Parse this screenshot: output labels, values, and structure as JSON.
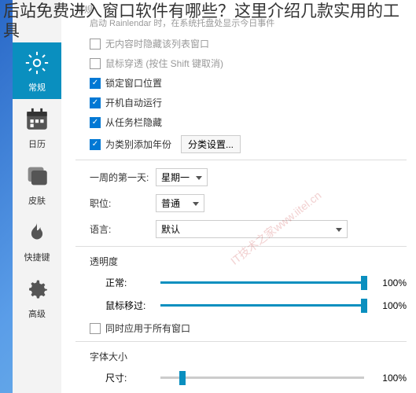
{
  "overlay": {
    "text": "后站免费进入窗口软件有哪些？这里介绍几款实用的工具"
  },
  "watermark": "IT技术之家www.iitel.cn",
  "section": {
    "title": "常规",
    "hint": "启动 Rainlendar 时，在系统托盘处显示今日事件"
  },
  "sidebar": {
    "items": [
      {
        "label": "常规",
        "icon": "gear"
      },
      {
        "label": "日历",
        "icon": "calendar"
      },
      {
        "label": "皮肤",
        "icon": "window"
      },
      {
        "label": "快捷键",
        "icon": "flame"
      },
      {
        "label": "高级",
        "icon": "cog"
      }
    ]
  },
  "checkboxes": {
    "hide_no_content": {
      "label": "无内容时隐藏该列表窗口",
      "checked": false
    },
    "mouse_through": {
      "label": "鼠标穿透 (按住 Shift 键取消)",
      "checked": false
    },
    "lock_position": {
      "label": "锁定窗口位置",
      "checked": true
    },
    "autostart": {
      "label": "开机自动运行",
      "checked": true
    },
    "hide_taskbar": {
      "label": "从任务栏隐藏",
      "checked": true
    },
    "year_category": {
      "label": "为类别添加年份",
      "checked": true
    },
    "apply_all": {
      "label": "同时应用于所有窗口",
      "checked": false
    }
  },
  "buttons": {
    "category_settings": "分类设置..."
  },
  "form": {
    "week_start": {
      "label": "一周的第一天:",
      "value": "星期一"
    },
    "position": {
      "label": "职位:",
      "value": "普通"
    },
    "language": {
      "label": "语言:",
      "value": "默认"
    }
  },
  "opacity": {
    "title": "透明度",
    "normal": {
      "label": "正常:",
      "value": "100%"
    },
    "hover": {
      "label": "鼠标移过:",
      "value": "100%"
    }
  },
  "fontsize": {
    "title": "字体大小",
    "size": {
      "label": "尺寸:",
      "value": "100%"
    }
  }
}
